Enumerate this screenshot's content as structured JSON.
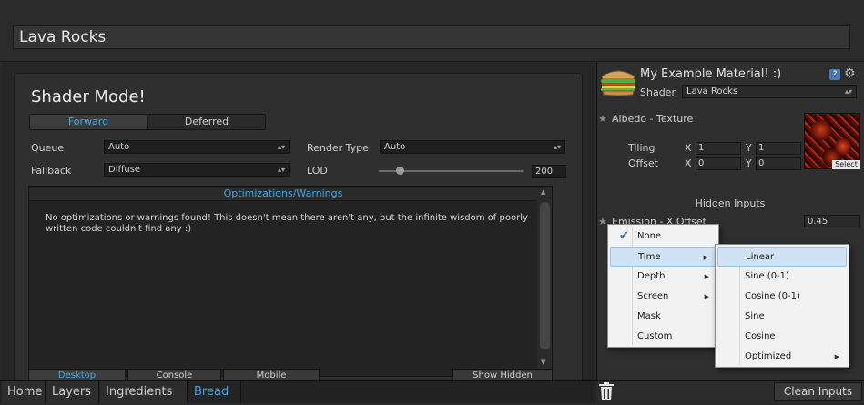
{
  "window": {
    "title": "Lava Rocks"
  },
  "shader_mode": {
    "title": "Shader Mode!",
    "tabs": [
      "Forward",
      "Deferred"
    ],
    "active_tab": "Forward",
    "queue_label": "Queue",
    "queue_value": "Auto",
    "render_type_label": "Render Type",
    "render_type_value": "Auto",
    "fallback_label": "Fallback",
    "fallback_value": "Diffuse",
    "lod_label": "LOD",
    "lod_value": "200",
    "lod_fraction": 0.15
  },
  "optimizations": {
    "header": "Optimizations/Warnings",
    "message": "No optimizations or warnings found! This doesn't mean there aren't any, but the infinite wisdom of poorly written code couldn't find any :)"
  },
  "platform_tabs": [
    "Desktop",
    "Console",
    "Mobile"
  ],
  "show_hidden_label": "Show Hidden",
  "nav": {
    "items": [
      "Home",
      "Layers",
      "Ingredients",
      "Bread"
    ],
    "active": "Bread"
  },
  "inspector": {
    "material_name": "My Example Material! :)",
    "help_label": "?",
    "shader_label": "Shader",
    "shader_value": "Lava Rocks",
    "albedo_label": "Albedo - Texture",
    "tiling_label": "Tiling",
    "offset_label": "Offset",
    "x_axis": "X",
    "y_axis": "Y",
    "tiling_x": "1",
    "tiling_y": "1",
    "offset_x": "0",
    "offset_y": "0",
    "select_label": "Select",
    "hidden_inputs_label": "Hidden Inputs",
    "emission_label": "Emission - X Offset",
    "emission_value": "0.45",
    "clean_inputs_label": "Clean Inputs"
  },
  "menu1": {
    "items": [
      "None",
      "Time",
      "Depth",
      "Screen",
      "Mask",
      "Custom"
    ],
    "checked": "None",
    "highlighted": "Time"
  },
  "menu2": {
    "items": [
      "Linear",
      "Sine (0-1)",
      "Cosine (0-1)",
      "Sine",
      "Cosine",
      "Optimized"
    ],
    "highlighted": "Linear"
  },
  "icons": {
    "sandwich": "sandwich-icon",
    "help": "help-icon",
    "settings": "gear-icon",
    "trash": "trash-icon",
    "check": "check-icon"
  },
  "colors": {
    "accent": "#3ea9e8"
  }
}
